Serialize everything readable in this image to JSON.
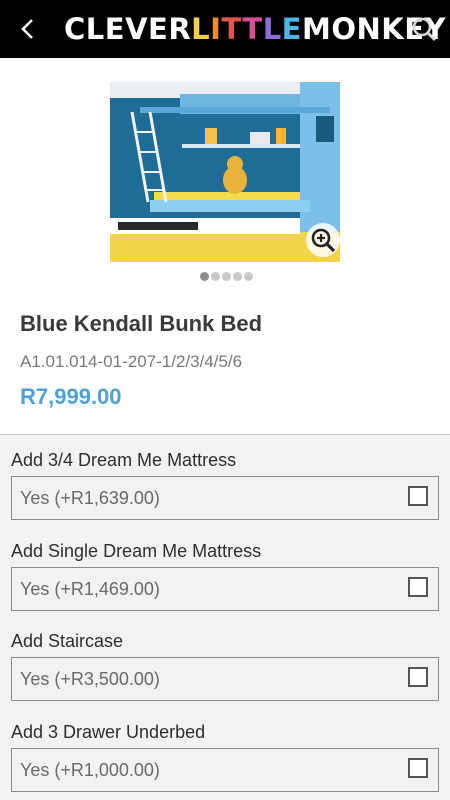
{
  "header": {
    "logo_clever": "CLEVER",
    "logo_little": "LITTLE",
    "logo_monkey": "MONKEY",
    "back_icon": "chevron-left-icon",
    "search_icon": "search-icon",
    "little_colors": [
      "#f6d04d",
      "#f08a2c",
      "#e2574c",
      "#d94d95",
      "#8e6fd6",
      "#4fb5e6"
    ]
  },
  "product": {
    "title": "Blue Kendall Bunk Bed",
    "sku": "A1.01.014-01-207-1/2/3/4/5/6",
    "price": "R7,999.00",
    "carousel_total": 5,
    "carousel_active": 0,
    "zoom_icon": "zoom-in-icon"
  },
  "options": [
    {
      "label": "Add 3/4 Dream Me Mattress",
      "value": "Yes (+R1,639.00)",
      "checked": false
    },
    {
      "label": "Add Single Dream Me Mattress",
      "value": "Yes (+R1,469.00)",
      "checked": false
    },
    {
      "label": "Add Staircase",
      "value": "Yes (+R3,500.00)",
      "checked": false
    },
    {
      "label": "Add 3 Drawer Underbed",
      "value": "Yes (+R1,000.00)",
      "checked": false
    }
  ]
}
